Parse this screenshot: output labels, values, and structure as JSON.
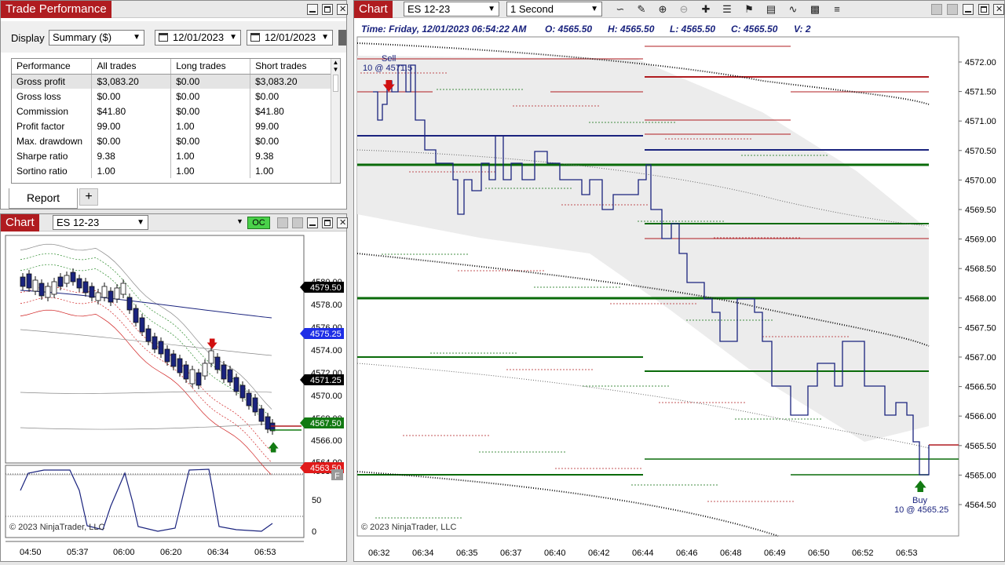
{
  "trade_perf": {
    "title": "Trade Performance",
    "display_label": "Display",
    "display_value": "Summary ($)",
    "date_from": "12/01/2023",
    "date_to": "12/01/2023",
    "columns": [
      "Performance",
      "All trades",
      "Long trades",
      "Short trades"
    ],
    "rows": [
      [
        "Gross profit",
        "$3,083.20",
        "$0.00",
        "$3,083.20"
      ],
      [
        "Gross loss",
        "$0.00",
        "$0.00",
        "$0.00"
      ],
      [
        "Commission",
        "$41.80",
        "$0.00",
        "$41.80"
      ],
      [
        "Profit factor",
        "99.00",
        "1.00",
        "99.00"
      ],
      [
        "Max. drawdown",
        "$0.00",
        "$0.00",
        "$0.00"
      ],
      [
        "Sharpe ratio",
        "9.38",
        "1.00",
        "9.38"
      ],
      [
        "Sortino ratio",
        "1.00",
        "1.00",
        "1.00"
      ]
    ],
    "tab_label": "Report",
    "add_tab": "+"
  },
  "small_chart": {
    "title": "Chart",
    "instrument": "ES 12-23",
    "oc": "OC",
    "copyright": "© 2023 NinjaTrader, LLC",
    "f_label": "F",
    "y_ticks": [
      "4580.00",
      "4578.00",
      "4576.00",
      "4574.00",
      "4572.00",
      "4570.00",
      "4568.00",
      "4566.00",
      "4564.00",
      "4563.00"
    ],
    "badges": [
      {
        "text": "4579.50",
        "color": "#000000"
      },
      {
        "text": "4575.25",
        "color": "#1e2ee6"
      },
      {
        "text": "4571.25",
        "color": "#000000"
      },
      {
        "text": "4567.50",
        "color": "#127a12"
      },
      {
        "text": "4563.50",
        "color": "#e01a1a"
      }
    ],
    "osc_ticks": [
      "50",
      "0"
    ],
    "x_ticks": [
      "04:50",
      "05:37",
      "06:00",
      "06:20",
      "06:34",
      "06:53"
    ]
  },
  "main_chart": {
    "title": "Chart",
    "instrument": "ES 12-23",
    "interval": "1 Second",
    "header": "Time: Friday, 12/01/2023 06:54:22 AM",
    "ohlcv": [
      "O: 4565.50",
      "H: 4565.50",
      "L: 4565.50",
      "C: 4565.50",
      "V: 2"
    ],
    "sell_label": "Sell",
    "sell_detail": "10 @ 4571.5",
    "buy_label": "Buy",
    "buy_detail": "10 @ 4565.25",
    "copyright": "© 2023 NinjaTrader, LLC",
    "y_ticks": [
      "4572.00",
      "4571.50",
      "4571.00",
      "4570.50",
      "4570.00",
      "4569.50",
      "4569.00",
      "4568.50",
      "4568.00",
      "4567.50",
      "4567.00",
      "4566.50",
      "4566.00",
      "4565.50",
      "4565.00",
      "4564.50"
    ],
    "x_ticks": [
      "06:32",
      "06:34",
      "06:35",
      "06:37",
      "06:40",
      "06:42",
      "06:44",
      "06:46",
      "06:48",
      "06:49",
      "06:50",
      "06:52",
      "06:53"
    ]
  },
  "colors": {
    "title_red": "#b01c20",
    "price_line": "#1a237e",
    "green_line": "#0a6b0a",
    "red_line": "#b01c20",
    "blue_line": "#1a237e"
  }
}
